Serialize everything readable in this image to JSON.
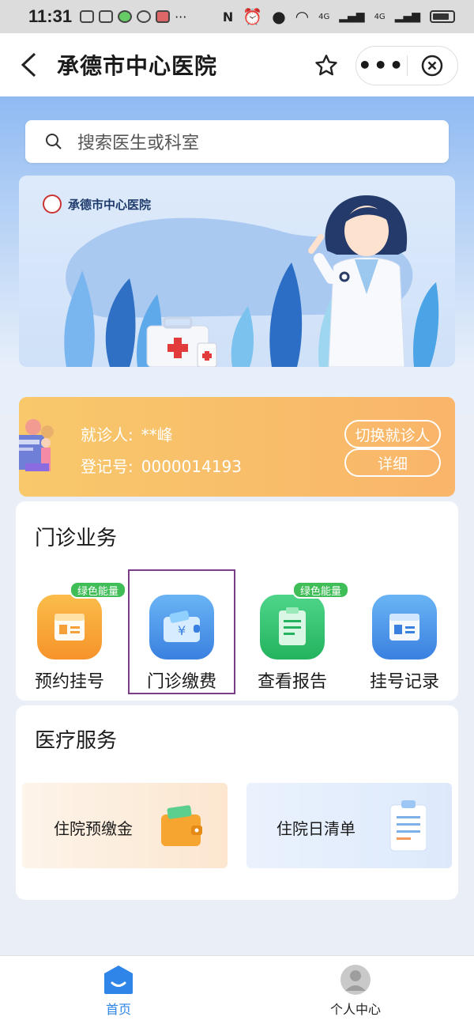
{
  "status_bar": {
    "time": "11:31",
    "signal_1": "4G",
    "signal_2": "4G"
  },
  "nav": {
    "title": "承德市中心医院",
    "more_label": "•••"
  },
  "search": {
    "placeholder": "搜索医生或科室"
  },
  "banner": {
    "hospital_name": "承德市中心医院"
  },
  "patient": {
    "name_label": "就诊人:",
    "name_value": "**峰",
    "reg_label": "登记号:",
    "reg_value": "0000014193",
    "switch_button": "切换就诊人",
    "detail_button": "详细"
  },
  "outpatient": {
    "title": "门诊业务",
    "items": [
      {
        "label": "预约挂号",
        "badge": "绿色能量",
        "icon": "calendar-card-icon",
        "color": "#f7a531"
      },
      {
        "label": "门诊缴费",
        "badge": "",
        "icon": "wallet-yuan-icon",
        "color": "#4a90e2"
      },
      {
        "label": "查看报告",
        "badge": "绿色能量",
        "icon": "clipboard-report-icon",
        "color": "#2fbf6a"
      },
      {
        "label": "挂号记录",
        "badge": "",
        "icon": "calendar-card-icon",
        "color": "#4a90e2"
      }
    ]
  },
  "medical": {
    "title": "医疗服务",
    "items": [
      {
        "label": "住院预缴金",
        "icon": "wallet-icon"
      },
      {
        "label": "住院日清单",
        "icon": "clipboard-list-icon"
      }
    ]
  },
  "tabbar": {
    "home": "首页",
    "profile": "个人中心"
  },
  "colors": {
    "accent_blue": "#2f86e8",
    "card_orange": "#f9b56a",
    "badge_green": "#3fbd57",
    "highlight": "#7a3d87"
  }
}
